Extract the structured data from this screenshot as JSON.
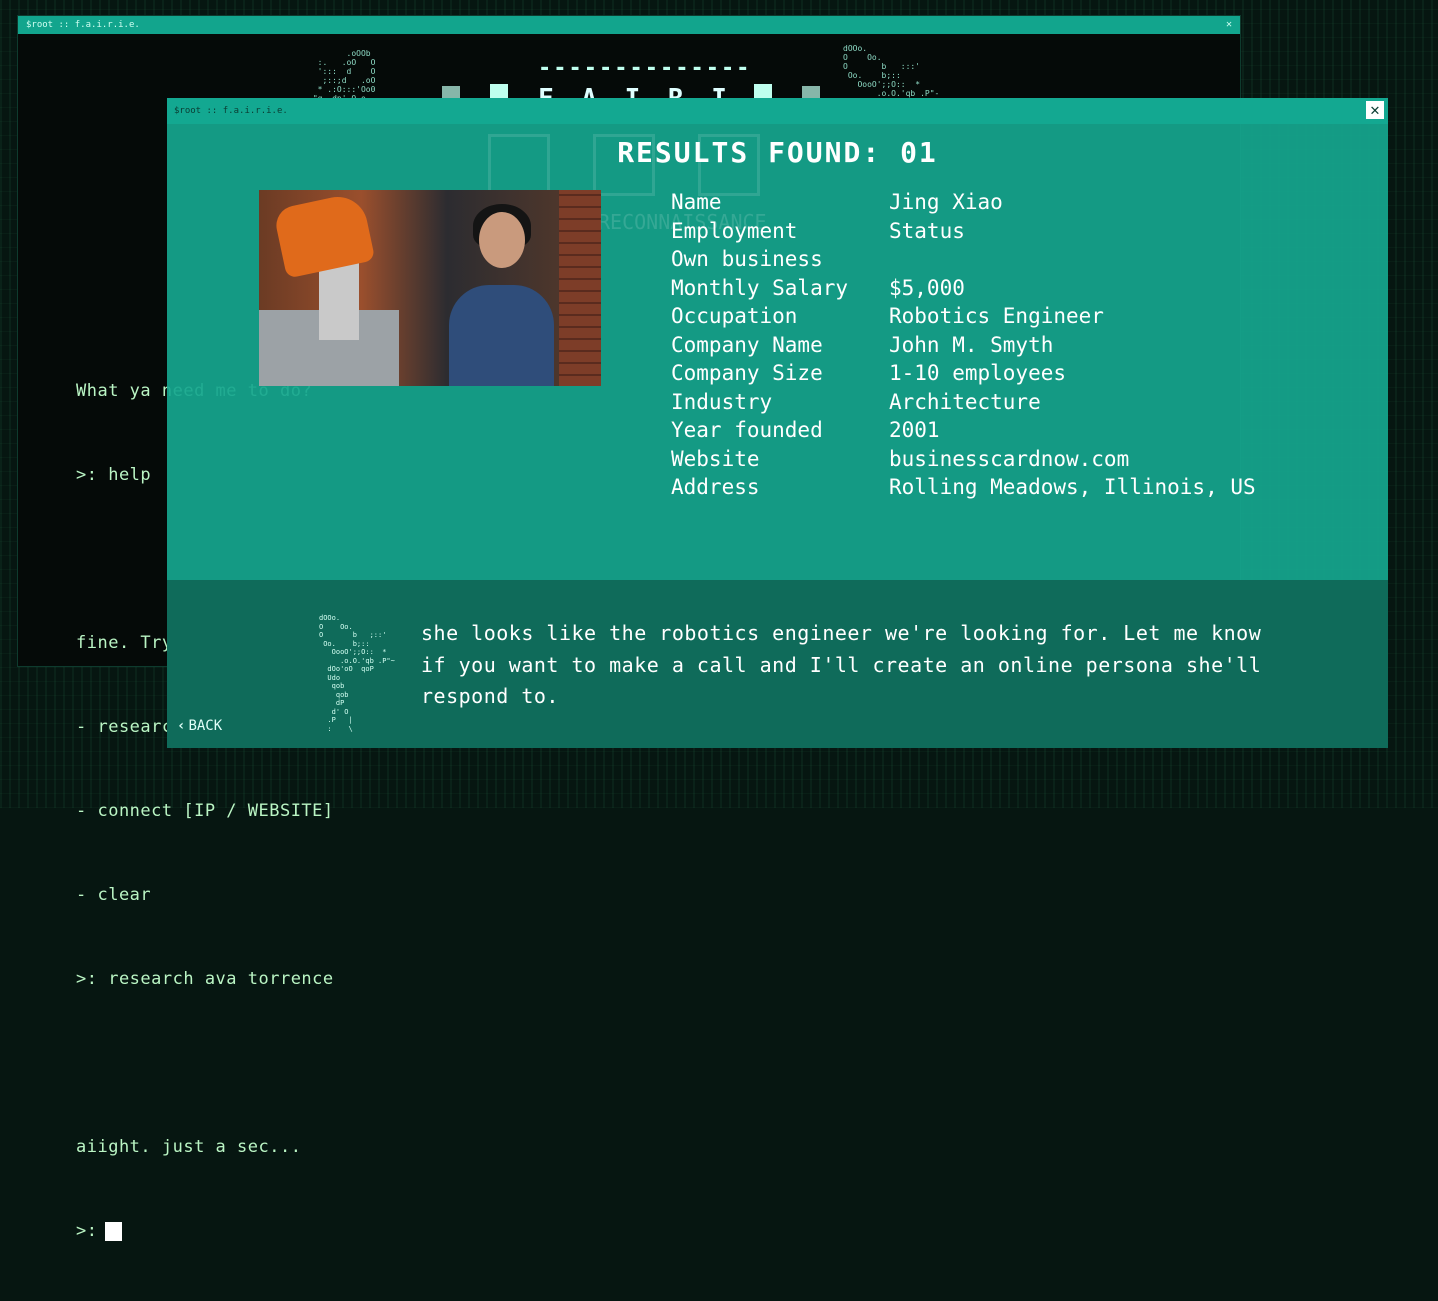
{
  "background_window": {
    "title": "$root :: f.a.i.r.i.e.",
    "logo_dashes": "--------------",
    "logo_title": "F.A.I.R.I.E.",
    "terminal": [
      "What ya need me to do?",
      ">: help",
      "",
      "fine. Try these commands:",
      "- research [TOPIC]",
      "- connect [IP / WEBSITE]",
      "- clear",
      ">: research ava torrence",
      "",
      "aiight. just a sec...",
      ">:"
    ]
  },
  "results_window": {
    "title": "$root :: f.a.i.r.i.e.",
    "close_label": "✕",
    "heading": "RESULTS FOUND: 01",
    "profile": [
      {
        "label": "Name",
        "value": "Jing Xiao"
      },
      {
        "label": "Employment",
        "value": "Status"
      },
      {
        "label": "Own business",
        "value": ""
      },
      {
        "label": "Monthly Salary",
        "value": "$5,000"
      },
      {
        "label": "Occupation",
        "value": "Robotics Engineer"
      },
      {
        "label": "Company Name",
        "value": "John M. Smyth"
      },
      {
        "label": "Company Size",
        "value": "1-10 employees"
      },
      {
        "label": "Industry",
        "value": "Architecture"
      },
      {
        "label": "Year founded",
        "value": "2001"
      },
      {
        "label": "Website",
        "value": "businesscardnow.com"
      },
      {
        "label": "Address",
        "value": "Rolling Meadows, Illinois, US"
      }
    ],
    "message": "she looks like the robotics engineer we're looking for. Let me know if you want to make a call and I'll create an online persona she'll respond to.",
    "back_label": "BACK",
    "faint_text": "RECONNAISSANCE"
  },
  "colors": {
    "panel": "#16a68e",
    "bottom_panel": "#0f6b5a",
    "terminal_text": "#baf5c4",
    "background": "#061611"
  },
  "icons": [
    "close-icon",
    "chevron-left-icon",
    "phone-icon",
    "mail-icon",
    "document-icon"
  ]
}
